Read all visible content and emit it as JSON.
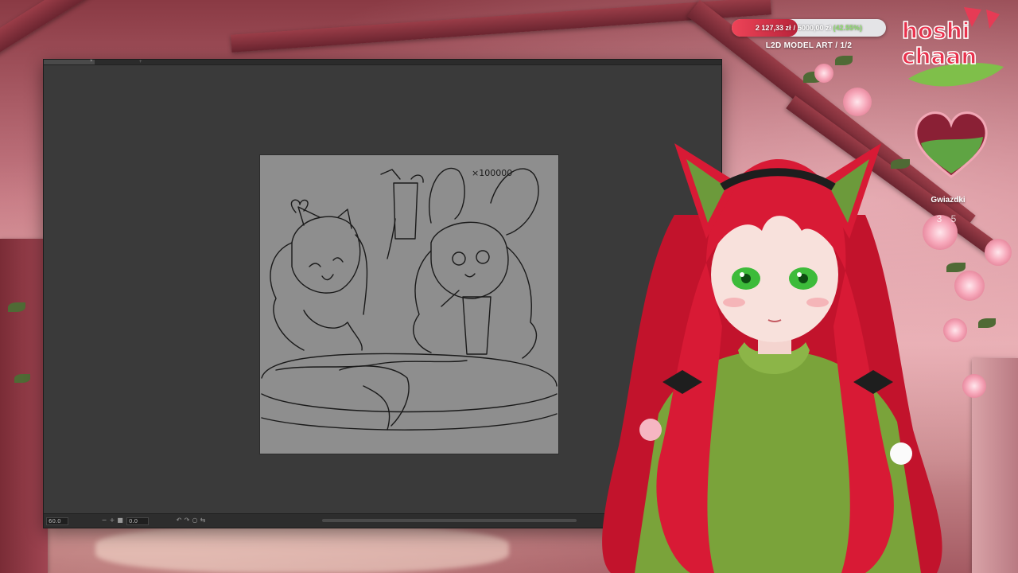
{
  "overlay": {
    "goal": {
      "current": "2 127,33 zł",
      "separator": "/",
      "target": "5000,00 zł",
      "percent": "(42.55%)",
      "progress": 0.4255,
      "label": "L2D MODEL ART / 1/2",
      "fill_color": "#e03a4c"
    },
    "logo_text": [
      "hoshi",
      "chaan"
    ],
    "stars": {
      "label": "Gwiazdki",
      "value": "3 5"
    }
  },
  "app": {
    "statusbar": {
      "zoom": "60.0",
      "rotation": "0.0"
    },
    "canvas": {
      "caption": "×100000"
    }
  },
  "colors": {
    "canvas_bg": "#8e8e8e",
    "app_bg": "#3a3a3a",
    "accent": "#e03a4c"
  }
}
